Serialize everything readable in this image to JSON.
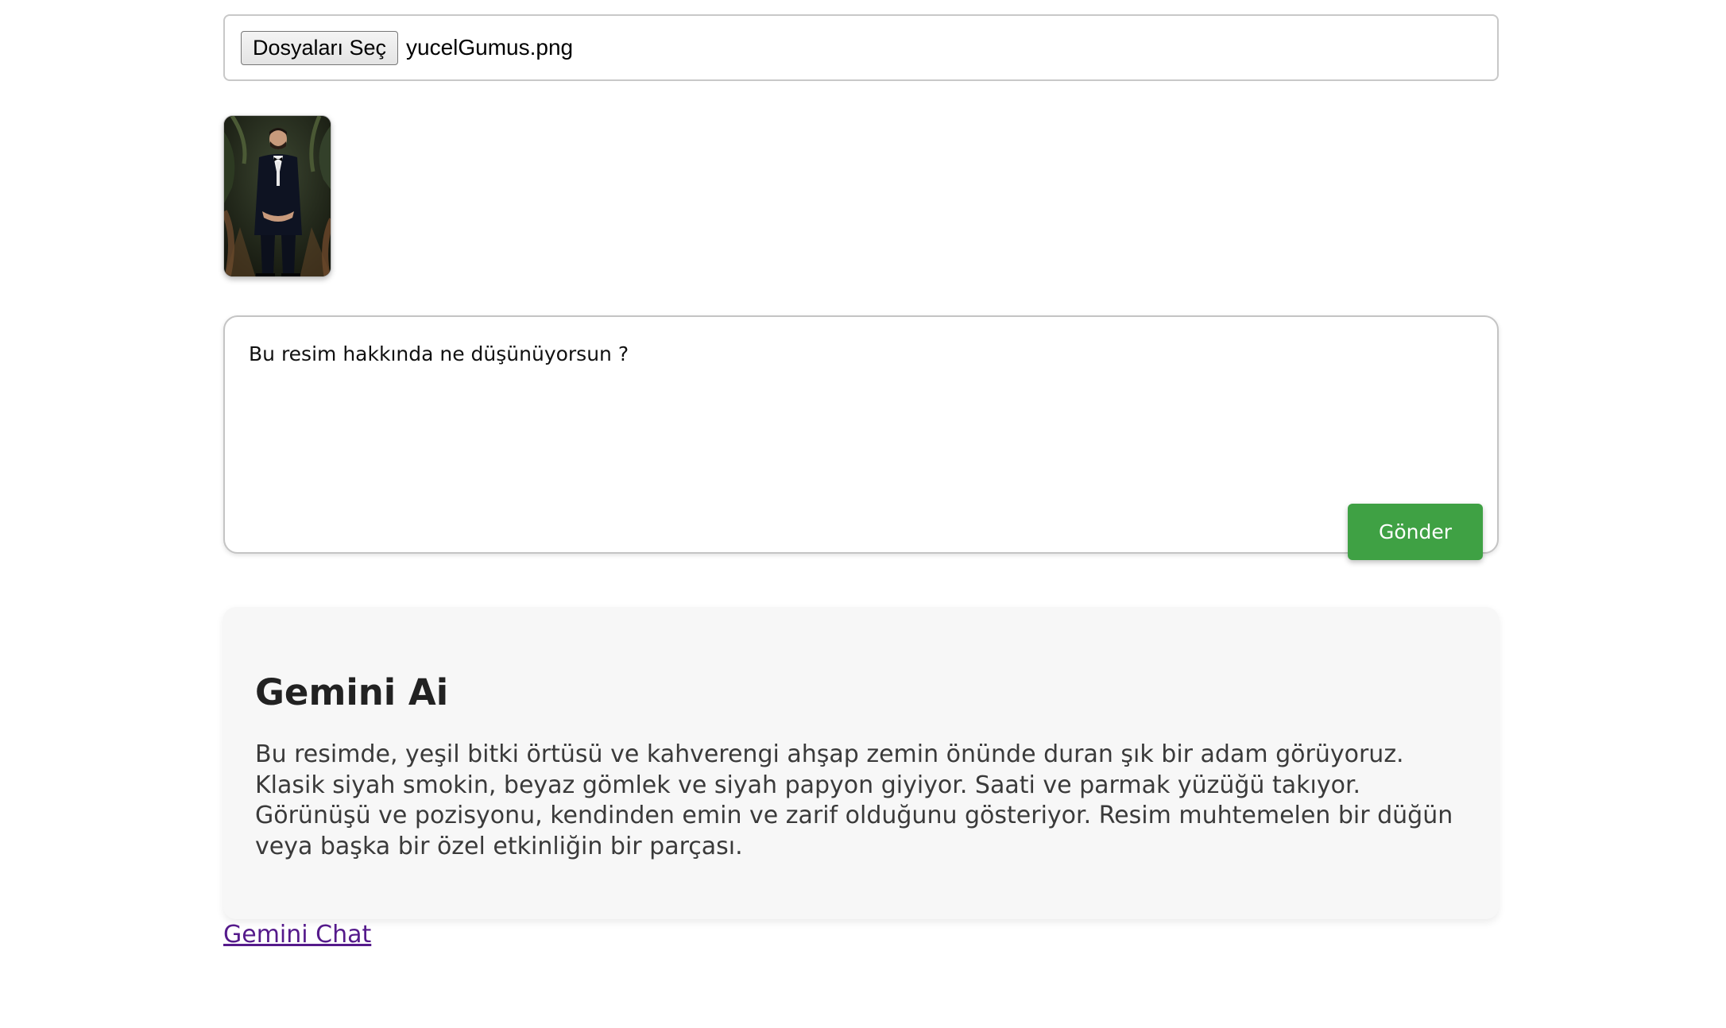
{
  "upload": {
    "button_label": "Dosyaları Seç",
    "file_name": "yucelGumus.png"
  },
  "preview": {
    "alt": "uploaded photo preview"
  },
  "prompt": {
    "text": "Bu resim hakkında ne düşünüyorsun ?"
  },
  "send_button": {
    "label": "Gönder"
  },
  "response": {
    "title": "Gemini Ai",
    "body": "Bu resimde, yeşil bitki örtüsü ve kahverengi ahşap zemin önünde duran şık bir adam görüyoruz. Klasik siyah smokin, beyaz gömlek ve siyah papyon giyiyor. Saati ve parmak yüzüğü takıyor. Görünüşü ve pozisyonu, kendinden emin ve zarif olduğunu gösteriyor. Resim muhtemelen bir düğün veya başka bir özel etkinliğin bir parçası."
  },
  "footer": {
    "link_label": "Gemini Chat"
  },
  "colors": {
    "send_button": "#3fa144",
    "card_background": "#f7f7f7",
    "link": "#551a8b"
  }
}
